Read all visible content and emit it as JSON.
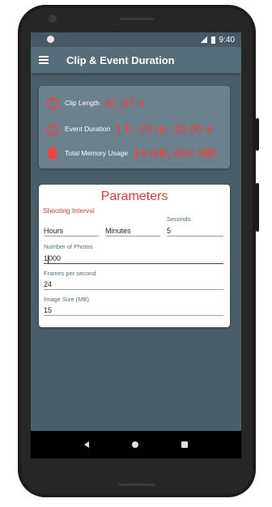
{
  "status_bar": {
    "time": "9:40"
  },
  "app_bar": {
    "title": "Clip & Event Duration"
  },
  "results": {
    "clip_length": {
      "label": "Clip Length",
      "value": "41.67 s",
      "icon": "stopwatch-icon"
    },
    "event_duration": {
      "label": "Event Duration",
      "value": "1 h, 23 m, 20.00 s",
      "icon": "stopwatch-icon"
    },
    "memory": {
      "label": "Total Memory Usage",
      "value": "14 GB, 664 MB",
      "icon": "sd-card-icon"
    }
  },
  "parameters": {
    "title": "Parameters",
    "shooting_interval_label": "Shooting Interval",
    "hours": {
      "placeholder": "Hours",
      "value": ""
    },
    "minutes": {
      "placeholder": "Minutes",
      "value": ""
    },
    "seconds": {
      "label": "Seconds",
      "value": "5"
    },
    "number_of_photos": {
      "label": "Number of Photos",
      "value_before_cursor": "1",
      "value_after_cursor": "000"
    },
    "frames_per_second": {
      "label": "Frames per second",
      "value": "24"
    },
    "image_size": {
      "label": "Image Size (MB)",
      "value": "15"
    }
  },
  "colors": {
    "accent_red": "#e53935",
    "value_red": "#ff3b3b",
    "toolbar": "#546e7a",
    "background": "#4a5e68"
  }
}
